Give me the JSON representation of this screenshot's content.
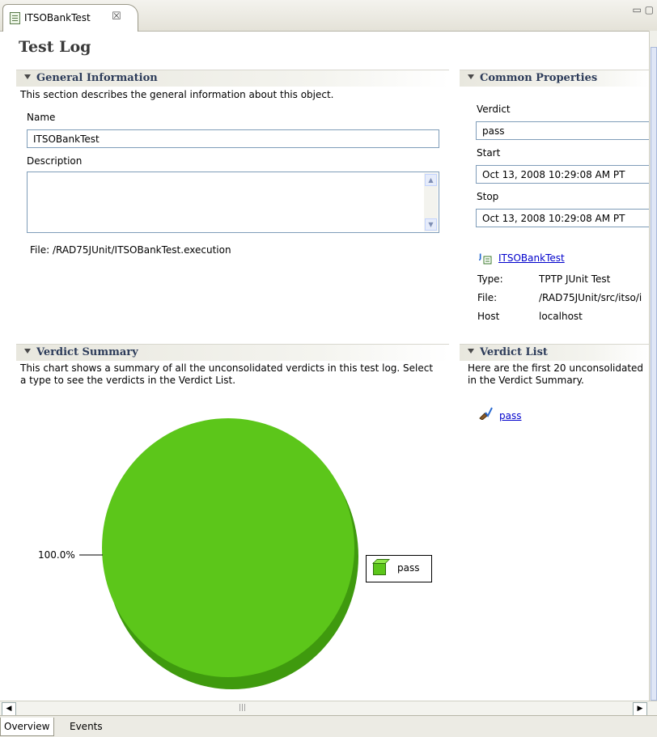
{
  "editor": {
    "tab_title": "ITSOBankTest",
    "close_glyph": "☒",
    "window_controls": "▭ ▢"
  },
  "page_title": "Test Log",
  "general": {
    "title": "General Information",
    "description": "This section describes the general information about this object.",
    "name_label": "Name",
    "name_value": "ITSOBankTest",
    "description_label": "Description",
    "description_value": "",
    "file_text": "File:  /RAD75JUnit/ITSOBankTest.execution"
  },
  "common": {
    "title": "Common Properties",
    "verdict_label": "Verdict",
    "verdict_value": "pass",
    "start_label": "Start",
    "start_value": "Oct 13, 2008 10:29:08 AM PT",
    "stop_label": "Stop",
    "stop_value": "Oct 13, 2008 10:29:08 AM PT",
    "test_link": "ITSOBankTest",
    "type_label": "Type:",
    "type_value": "TPTP JUnit Test",
    "file_label": "File:",
    "file_value": "/RAD75JUnit/src/itso/i",
    "host_label": "Host",
    "host_value": "localhost"
  },
  "verdict_summary": {
    "title": "Verdict Summary",
    "desc_line1": "This chart shows a summary of all the unconsolidated verdicts in this test log. Select",
    "desc_line2": "a type to see the verdicts in the Verdict List."
  },
  "verdict_list": {
    "title": "Verdict List",
    "desc_line1": "Here are the first 20 unconsolidated",
    "desc_line2": "in the Verdict Summary.",
    "item": "pass"
  },
  "chart_data": {
    "type": "pie",
    "categories": [
      "pass"
    ],
    "values": [
      100.0
    ],
    "data_labels": [
      "100.0%"
    ],
    "legend": [
      "pass"
    ],
    "legend_placement": "right",
    "colors": [
      "#5cc61a"
    ]
  },
  "bottom_tabs": [
    "Overview",
    "Events"
  ],
  "colors": {
    "pie_fill": "#5cc61a",
    "pie_side": "#3f9a0e",
    "link": "#0000cc",
    "section_title": "#2d3c5a"
  }
}
